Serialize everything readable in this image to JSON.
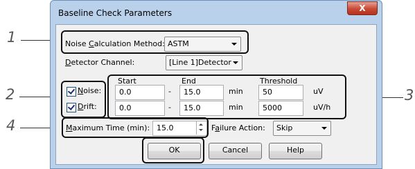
{
  "dialog": {
    "title": "Baseline Check Parameters",
    "close_label": "X"
  },
  "callouts": {
    "c1": "1",
    "c2": "2",
    "c3": "3",
    "c4": "4"
  },
  "noise_method": {
    "label_pre": "Noise ",
    "label_key": "C",
    "label_post": "alculation Method:",
    "value": "ASTM"
  },
  "detector": {
    "label_key": "D",
    "label_post": "etector Channel:",
    "value": "[Line 1]Detector"
  },
  "columns": {
    "start": "Start",
    "end": "End",
    "threshold": "Threshold"
  },
  "noise": {
    "checked": true,
    "label_key": "N",
    "label_post": "oise:",
    "start": "0.0",
    "dash": "-",
    "end": "15.0",
    "time_unit": "min",
    "threshold": "50",
    "unit": "uV"
  },
  "drift": {
    "checked": true,
    "label_key": "D",
    "label_post": "rift:",
    "start": "0.0",
    "dash": "-",
    "end": "15.0",
    "time_unit": "min",
    "threshold": "5000",
    "unit": "uV/h"
  },
  "max_time": {
    "label_key": "M",
    "label_post": "aximum Time (min):",
    "value": "15.0"
  },
  "failure": {
    "label_pre": "F",
    "label_key": "a",
    "label_post": "ilure Action:",
    "value": "Skip"
  },
  "buttons": {
    "ok": "OK",
    "cancel": "Cancel",
    "help": "Help"
  },
  "colors": {
    "frame": "#b9d1ea",
    "close": "#c74a36",
    "client": "#f0f0f0",
    "callout_line": "#333333"
  }
}
